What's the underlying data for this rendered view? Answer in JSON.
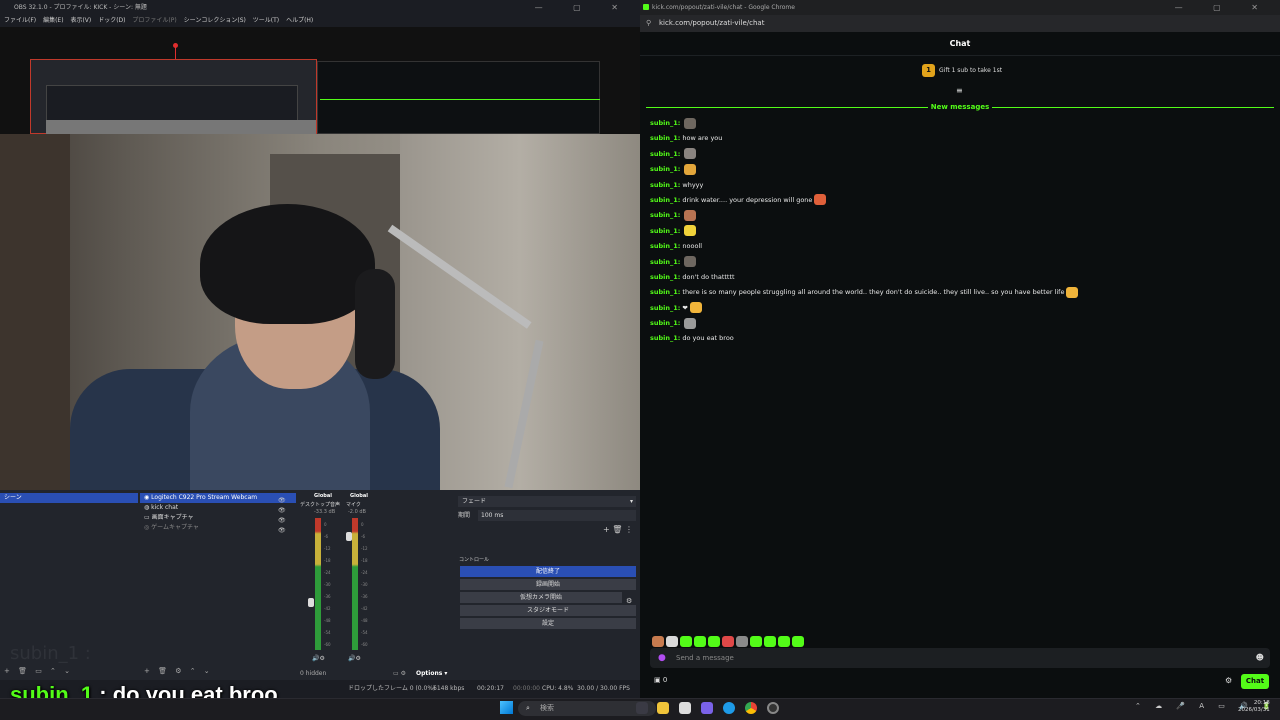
{
  "obs": {
    "title": "OBS 32.1.0 - プロファイル: KICK - シーン: 無題",
    "menu": [
      "ファイル(F)",
      "編集(E)",
      "表示(V)",
      "ドック(D)",
      "プロファイル(P)",
      "シーンコレクション(S)",
      "ツール(T)",
      "ヘルプ(H)"
    ],
    "scenes": {
      "items": [
        "シーン"
      ]
    },
    "sources": {
      "items": [
        "Logitech C922 Pro Stream Webcam",
        "kick chat",
        "画面キャプチャ",
        "ゲームキャプチャ"
      ]
    },
    "mixer": {
      "channels": [
        {
          "label": "Global",
          "name": "デスクトップ音声",
          "db": "-33.3 dB"
        },
        {
          "label": "Global",
          "name": "マイク",
          "db": "-2.0 dB"
        }
      ],
      "ticks": [
        "0",
        "-6",
        "-12",
        "-18",
        "-24",
        "-30",
        "-36",
        "-42",
        "-48",
        "-54",
        "-60"
      ],
      "hidden": "0 hidden",
      "options": "Options"
    },
    "transition": {
      "value": "フェード",
      "duration_label": "期間",
      "duration": "100 ms"
    },
    "controls": {
      "title": "コントロール",
      "buttons": [
        "配信終了",
        "録画開始",
        "仮想カメラ開始",
        "スタジオモード",
        "設定"
      ]
    },
    "status": {
      "dropped": "ドロップしたフレーム 0 (0.0%)",
      "kbps": "6148 kbps",
      "stream_time": "00:20:17",
      "rec_time": "00:00:00",
      "cpu": "CPU: 4.8%",
      "fps": "30.00 / 30.00 FPS"
    },
    "faded_name": "subin_1 :"
  },
  "caption": {
    "user": "subin_1",
    "text": ": do you eat broo"
  },
  "chrome": {
    "title": "kick.com/popout/zati-vile/chat - Google Chrome",
    "url": "kick.com/popout/zati-vile/chat",
    "header": "Chat",
    "gift_badge": "1",
    "gift_text": "Gift 1 sub to take 1st",
    "new_messages": "New messages",
    "messages": [
      {
        "user": "subin_1:",
        "text": "",
        "emote": "#6e6760"
      },
      {
        "user": "subin_1:",
        "text": "how are you",
        "emote": ""
      },
      {
        "user": "subin_1:",
        "text": "",
        "emote": "#8a8480"
      },
      {
        "user": "subin_1:",
        "text": "",
        "emote": "#e2a63b"
      },
      {
        "user": "subin_1:",
        "text": "whyyy",
        "emote": ""
      },
      {
        "user": "subin_1:",
        "text": "drink water.... your depression will gone",
        "emote": "#e0603a"
      },
      {
        "user": "subin_1:",
        "text": "",
        "emote": "#b87352"
      },
      {
        "user": "subin_1:",
        "text": "",
        "emote": "#f0d23a"
      },
      {
        "user": "subin_1:",
        "text": "noooll",
        "emote": ""
      },
      {
        "user": "subin_1:",
        "text": "",
        "emote": "#6e6760"
      },
      {
        "user": "subin_1:",
        "text": "don't do thattttt",
        "emote": ""
      },
      {
        "user": "subin_1:",
        "text": "there is so many people struggling all around the world.. they don't do suicide.. they still live.. so you have better life",
        "emote": "#f0b43a"
      },
      {
        "user": "subin_1:",
        "text": "❤",
        "emote": "#f0b43a"
      },
      {
        "user": "subin_1:",
        "text": "",
        "emote": "#9a9a9a"
      },
      {
        "user": "subin_1:",
        "text": "do you eat broo",
        "emote": ""
      }
    ],
    "emote_bar": [
      "#c77b4f",
      "#d9d9d9",
      "#53fc18",
      "#53fc18",
      "#53fc18",
      "#e04848",
      "#8a8a8a",
      "#53fc18",
      "#53fc18",
      "#53fc18",
      "#53fc18"
    ],
    "input_placeholder": "Send a message",
    "viewer_count": "0",
    "chat_button": "Chat",
    "accent": "#53fc18"
  },
  "taskbar": {
    "search_placeholder": "検索",
    "time": "20:18",
    "date": "2026/03/31",
    "ime": "A"
  }
}
